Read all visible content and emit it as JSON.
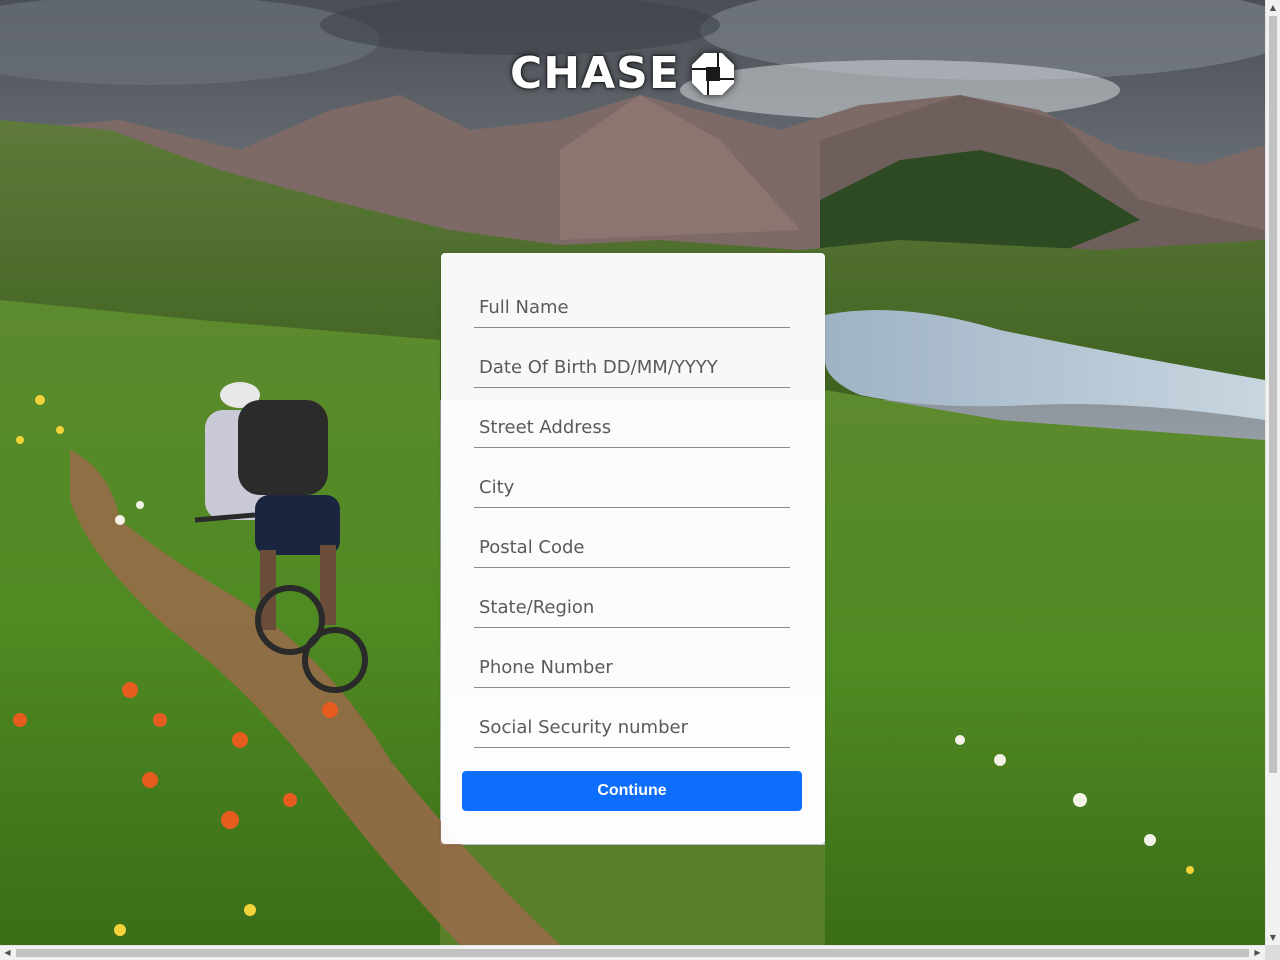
{
  "brand": {
    "name": "CHASE",
    "color": "#ffffff"
  },
  "form": {
    "fields": [
      {
        "placeholder": "Full Name"
      },
      {
        "placeholder": "Date Of Birth DD/MM/YYYY"
      },
      {
        "placeholder": "Street Address"
      },
      {
        "placeholder": "City"
      },
      {
        "placeholder": "Postal Code"
      },
      {
        "placeholder": "State/Region"
      },
      {
        "placeholder": "Phone Number"
      },
      {
        "placeholder": "Social Security number"
      }
    ],
    "submit_label": "Contiune"
  },
  "colors": {
    "button": "#0d6efd",
    "card": "#ffffff"
  },
  "icons": {
    "logo_mark": "chase-octagon-icon",
    "scroll_up": "arrow-up-icon",
    "scroll_down": "arrow-down-icon",
    "scroll_left": "arrow-left-icon",
    "scroll_right": "arrow-right-icon"
  }
}
